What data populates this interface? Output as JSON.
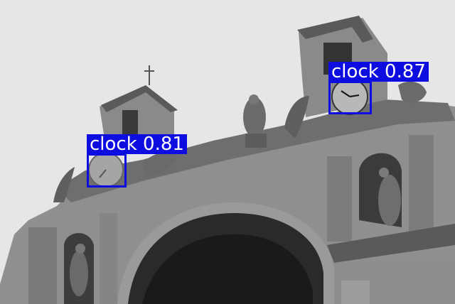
{
  "image": {
    "description_colors": {
      "sky": "#e6e6e6",
      "stone_light": "#9a9a9a",
      "stone_dark": "#4a4a4a",
      "shadow": "#1a1a1a"
    },
    "box_color": "#0d0de0",
    "label_text_color": "#ffffff"
  },
  "detections": [
    {
      "label": "clock 0.87"
    },
    {
      "label": "clock 0.81"
    }
  ]
}
